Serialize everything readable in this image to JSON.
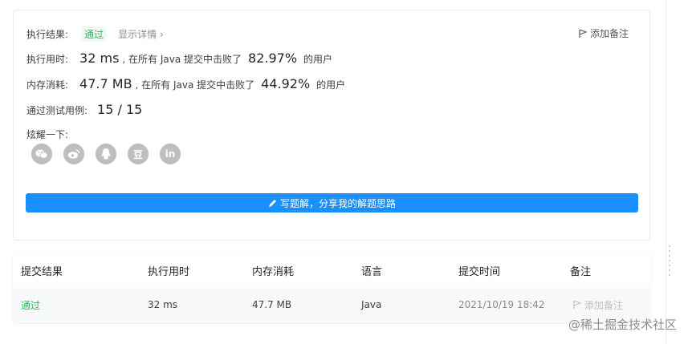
{
  "result": {
    "label": "执行结果:",
    "status": "通过",
    "details_link": "显示详情 ›",
    "add_note": "添加备注"
  },
  "runtime": {
    "label": "执行用时:",
    "value": "32 ms",
    "beat_prefix": ", 在所有 Java 提交中击败了",
    "percent": "82.97%",
    "suffix": "的用户"
  },
  "memory": {
    "label": "内存消耗:",
    "value": "47.7 MB",
    "beat_prefix": ", 在所有 Java 提交中击败了",
    "percent": "44.92%",
    "suffix": "的用户"
  },
  "testcases": {
    "label": "通过测试用例:",
    "value": "15 / 15"
  },
  "share": {
    "label": "炫耀一下:",
    "icons": [
      "wechat-icon",
      "weibo-icon",
      "qq-icon",
      "douban-icon",
      "linkedin-icon"
    ],
    "douban_glyph": "豆",
    "linkedin_glyph": "in"
  },
  "solution_button": "写题解，分享我的解题思路",
  "table": {
    "headers": [
      "提交结果",
      "执行用时",
      "内存消耗",
      "语言",
      "提交时间",
      "备注"
    ],
    "rows": [
      {
        "result": "通过",
        "runtime": "32 ms",
        "memory": "47.7 MB",
        "language": "Java",
        "time": "2021/10/19 18:42",
        "note": "添加备注"
      }
    ]
  },
  "watermark": "@稀土掘金技术社区",
  "colors": {
    "accent": "#1a90ff",
    "success": "#2db55d",
    "icon_gray": "#bfbfbf"
  }
}
